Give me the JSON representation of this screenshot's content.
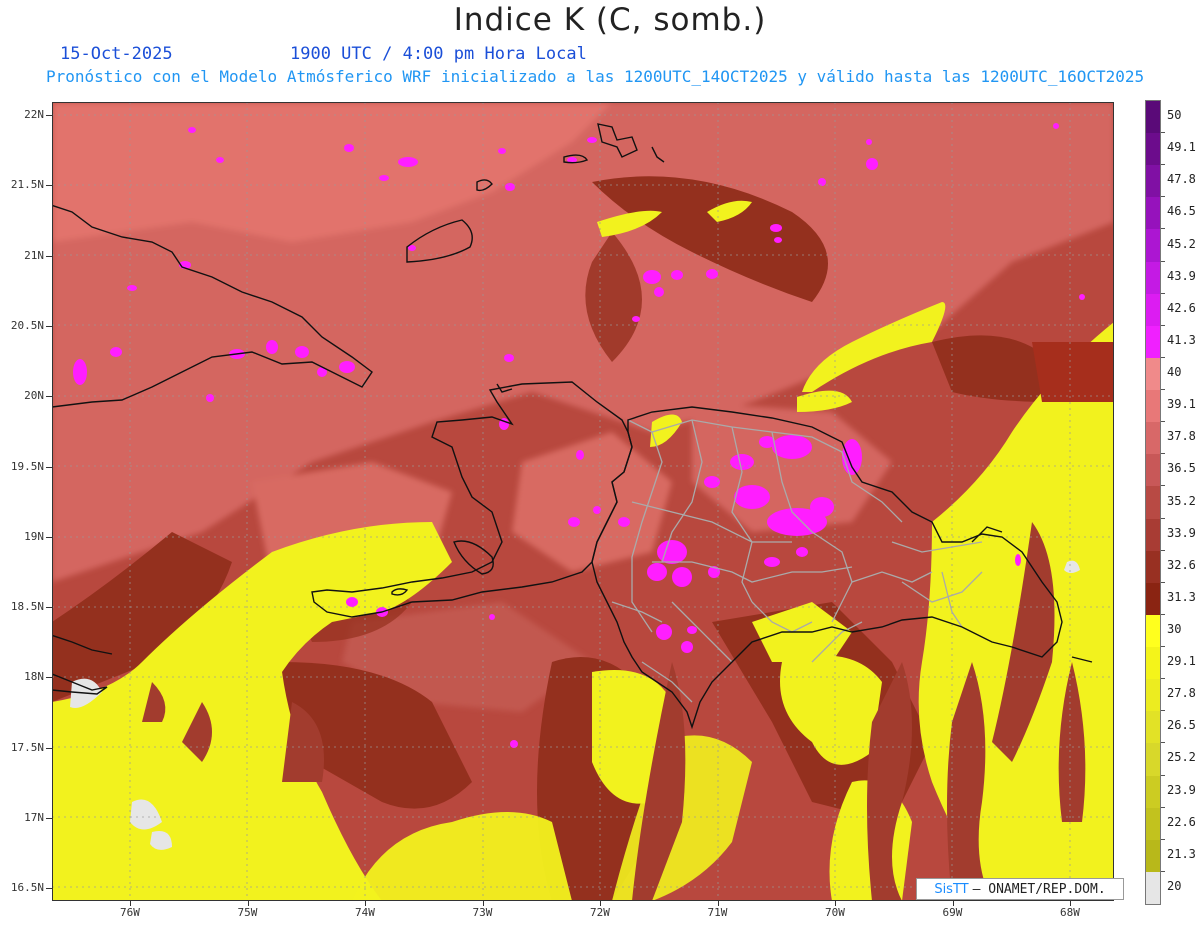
{
  "header": {
    "title": "Indice K (C, somb.)",
    "date": "15-Oct-2025",
    "time": "1900 UTC / 4:00 pm Hora Local",
    "model_line": "Pronóstico con el Modelo Atmósferico WRF inicializado a las 1200UTC_14OCT2025 y válido hasta las  1200UTC_16OCT2025"
  },
  "axes": {
    "lat_labels": [
      "22N",
      "21.5N",
      "21N",
      "20.5N",
      "20N",
      "19.5N",
      "19N",
      "18.5N",
      "18N",
      "17.5N",
      "17N",
      "16.5N"
    ],
    "lon_labels": [
      "76W",
      "75W",
      "74W",
      "73W",
      "72W",
      "71W",
      "70W",
      "69W",
      "68W"
    ]
  },
  "colorbar": {
    "labels": [
      "50",
      "49.1",
      "47.8",
      "46.5",
      "45.2",
      "43.9",
      "42.6",
      "41.3",
      "40",
      "39.1",
      "37.8",
      "36.5",
      "35.2",
      "33.9",
      "32.6",
      "31.3",
      "30",
      "29.1",
      "27.8",
      "26.5",
      "25.2",
      "23.9",
      "22.6",
      "21.3",
      "20"
    ],
    "colors": [
      "#5a0a78",
      "#6c0c8c",
      "#8010a4",
      "#9612bc",
      "#ac16d2",
      "#c41ae4",
      "#dc1cf2",
      "#f020ff",
      "#f08a8a",
      "#e87878",
      "#d86868",
      "#c85858",
      "#b84a44",
      "#a83c34",
      "#983022",
      "#8a2412",
      "#ffff1e",
      "#f4f41a",
      "#ecec20",
      "#e2e226",
      "#d8d82a",
      "#cccc22",
      "#c2c21e",
      "#b8b81a",
      "#e6e6e6"
    ]
  },
  "credit": {
    "brand": "SisTT",
    "org": " –  ONAMET/REP.DOM."
  },
  "palette": {
    "yellow": "#f2f21e",
    "brown": "#962e20",
    "salmon": "#cc5e56",
    "pink": "#e2706a",
    "magenta": "#ff1eff",
    "border": "#aaaaaa"
  }
}
